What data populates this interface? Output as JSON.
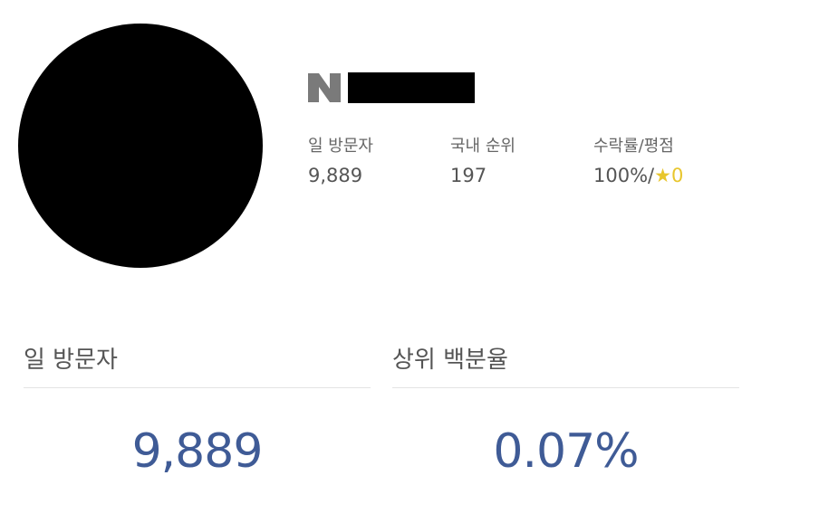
{
  "profile": {
    "logo_letter": "N",
    "logo_icon": "naver-n-logo-icon",
    "logo_color": "#7a7a7a"
  },
  "stats": [
    {
      "label": "일 방문자",
      "value": "9,889"
    },
    {
      "label": "국내 순위",
      "value": "197"
    },
    {
      "label": "수락률/평점",
      "value_prefix": "100%/",
      "rating_star": "★",
      "rating_score": "0"
    }
  ],
  "panels": [
    {
      "title": "일 방문자",
      "value": "9,889"
    },
    {
      "title": "상위 백분율",
      "value": "0.07%"
    }
  ],
  "colors": {
    "accent_blue": "#3f5b96",
    "star_yellow": "#e8c62d"
  }
}
